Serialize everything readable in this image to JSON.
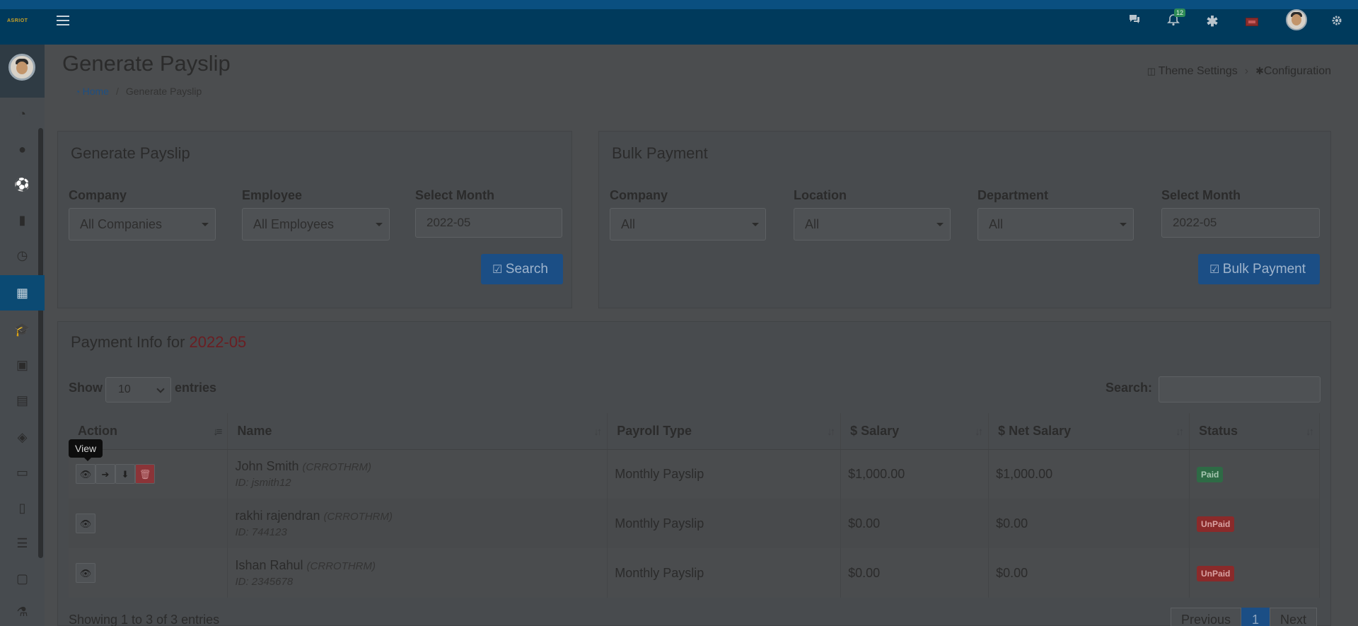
{
  "app": {
    "logo_text": "ASRIOT"
  },
  "topbar": {
    "menu_icon": "hamburger-icon",
    "icons": [
      "chat-icon",
      "bell-icon",
      "asterisk-icon",
      "flag-icon",
      "avatar",
      "gear-icon"
    ],
    "notification_count": "12"
  },
  "sidebar": {
    "items": [
      "dashboard-icon",
      "user-icon",
      "futbol-icon",
      "building-icon",
      "clock-icon",
      "calculator-icon",
      "graduation-cap-icon",
      "cube-icon",
      "calendar-icon",
      "ticket-icon",
      "id-card-icon",
      "file-icon",
      "server-icon",
      "money-icon",
      "flask-icon"
    ],
    "active_index": 5
  },
  "page": {
    "title": "Generate Payslip",
    "breadcrumb_home": "Home",
    "breadcrumb_current": "Generate Payslip",
    "theme_settings": "Theme Settings",
    "configuration": "Configuration"
  },
  "generate_card": {
    "title": "Generate Payslip",
    "company_label": "Company",
    "company_value": "All Companies",
    "employee_label": "Employee",
    "employee_value": "All Employees",
    "month_label": "Select Month",
    "month_value": "2022-05",
    "search_button": "Search"
  },
  "bulk_card": {
    "title": "Bulk Payment",
    "company_label": "Company",
    "company_value": "All",
    "location_label": "Location",
    "location_value": "All",
    "department_label": "Department",
    "department_value": "All",
    "month_label": "Select Month",
    "month_value": "2022-05",
    "bulk_button": "Bulk Payment"
  },
  "payment_info": {
    "title_prefix": "Payment Info for",
    "month": "2022-05",
    "show_label": "Show",
    "entries_value": "10",
    "entries_label": "entries",
    "search_label": "Search:",
    "columns": [
      "Action",
      "Name",
      "Payroll Type",
      "$ Salary",
      "$ Net Salary",
      "Status"
    ],
    "rows": [
      {
        "name": "John Smith",
        "company": "(CRROTHRM)",
        "id": "ID: jsmith12",
        "payroll_type": "Monthly Payslip",
        "salary": "$1,000.00",
        "net_salary": "$1,000.00",
        "status": "Paid"
      },
      {
        "name": "rakhi rajendran",
        "company": "(CRROTHRM)",
        "id": "ID: 744123",
        "payroll_type": "Monthly Payslip",
        "salary": "$0.00",
        "net_salary": "$0.00",
        "status": "UnPaid"
      },
      {
        "name": "Ishan Rahul",
        "company": "(CRROTHRM)",
        "id": "ID: 2345678",
        "payroll_type": "Monthly Payslip",
        "salary": "$0.00",
        "net_salary": "$0.00",
        "status": "UnPaid"
      }
    ],
    "tooltip": "View",
    "showing_text": "Showing 1 to 3 of 3 entries",
    "pager_previous": "Previous",
    "pager_current": "1",
    "pager_next": "Next"
  }
}
